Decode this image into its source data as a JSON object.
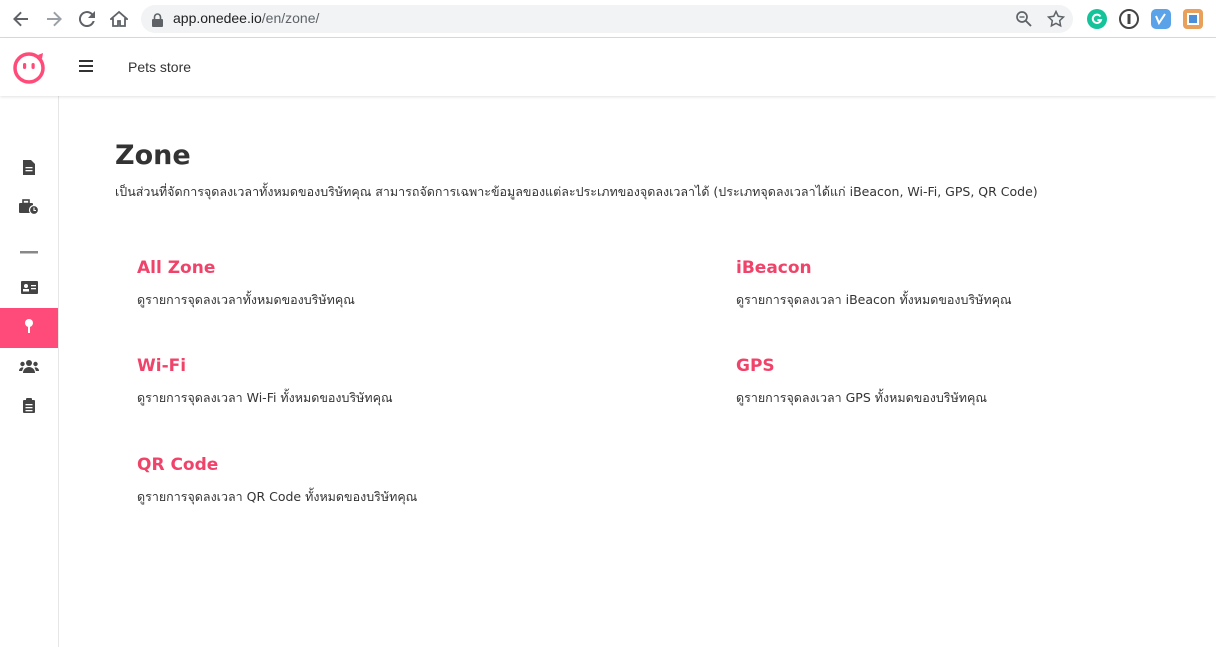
{
  "browser": {
    "url_host": "app.onedee.io",
    "url_path": "/en/zone/"
  },
  "header": {
    "store_name": "Pets store"
  },
  "colors": {
    "accent": "#ff4b79",
    "card_title": "#f0436a"
  },
  "sidebar": {
    "items": [
      {
        "icon": "document-icon"
      },
      {
        "icon": "briefcase-clock-icon"
      },
      {
        "icon": "divider-icon"
      },
      {
        "icon": "id-card-icon"
      },
      {
        "icon": "location-pin-icon",
        "active": true
      },
      {
        "icon": "users-icon"
      },
      {
        "icon": "clipboard-icon"
      }
    ]
  },
  "main": {
    "title": "Zone",
    "description": "เป็นส่วนที่จัดการจุดลงเวลาทั้งหมดของบริษัทคุณ สามารถจัดการเฉพาะข้อมูลของแต่ละประเภทของจุดลงเวลาได้ (ประเภทจุดลงเวลาได้แก่ iBeacon, Wi-Fi, GPS, QR Code)",
    "cards": [
      {
        "title": "All Zone",
        "desc": "ดูรายการจุดลงเวลาทั้งหมดของบริษัทคุณ"
      },
      {
        "title": "iBeacon",
        "desc": "ดูรายการจุดลงเวลา iBeacon ทั้งหมดของบริษัทคุณ"
      },
      {
        "title": "Wi-Fi",
        "desc": "ดูรายการจุดลงเวลา Wi-Fi ทั้งหมดของบริษัทคุณ"
      },
      {
        "title": "GPS",
        "desc": "ดูรายการจุดลงเวลา GPS ทั้งหมดของบริษัทคุณ"
      },
      {
        "title": "QR Code",
        "desc": "ดูรายการจุดลงเวลา QR Code ทั้งหมดของบริษัทคุณ"
      }
    ]
  }
}
